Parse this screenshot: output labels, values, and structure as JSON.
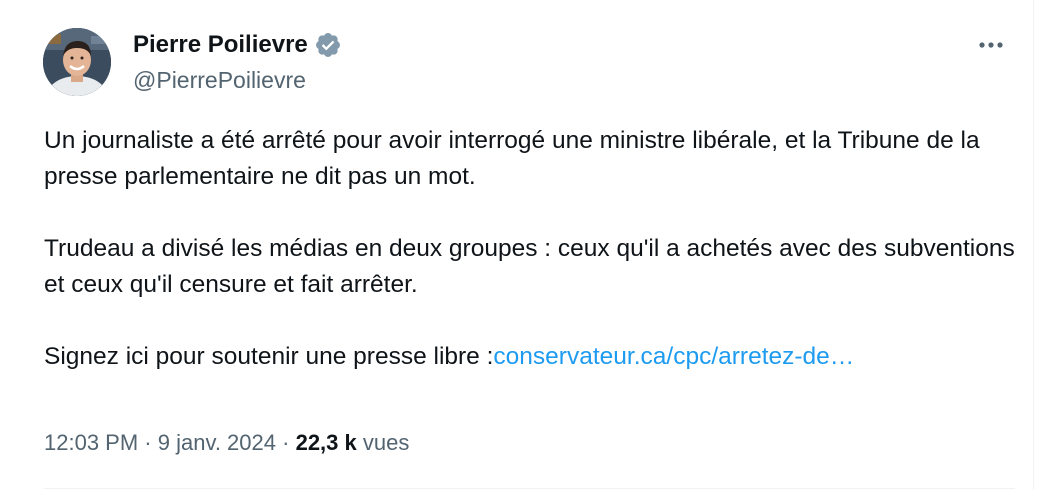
{
  "author": {
    "display_name": "Pierre Poilievre",
    "handle": "@PierrePoilievre",
    "verified": true,
    "verified_icon": "verified-badge-icon",
    "verified_color": "#829aab"
  },
  "more_icon": "more-horizontal-icon",
  "tweet": {
    "paragraph_1": "Un journaliste a été arrêté pour avoir interrogé une ministre libérale, et la Tribune de la presse parlementaire ne dit pas un mot.",
    "paragraph_2": "Trudeau a divisé les médias en deux groupes : ceux qu'il a achetés avec des subventions et ceux qu'il censure et fait arrêter.",
    "paragraph_3_text": "Signez ici pour soutenir une presse libre :",
    "link_text": "conservateur.ca/cpc/arretez-de…"
  },
  "meta": {
    "time": "12:03 PM",
    "separator": "·",
    "date": "9 janv. 2024",
    "views_count": "22,3 k",
    "views_label": "vues"
  },
  "colors": {
    "text": "#0f1419",
    "secondary": "#536471",
    "link": "#1d9bf0",
    "border": "#eff3f4"
  }
}
